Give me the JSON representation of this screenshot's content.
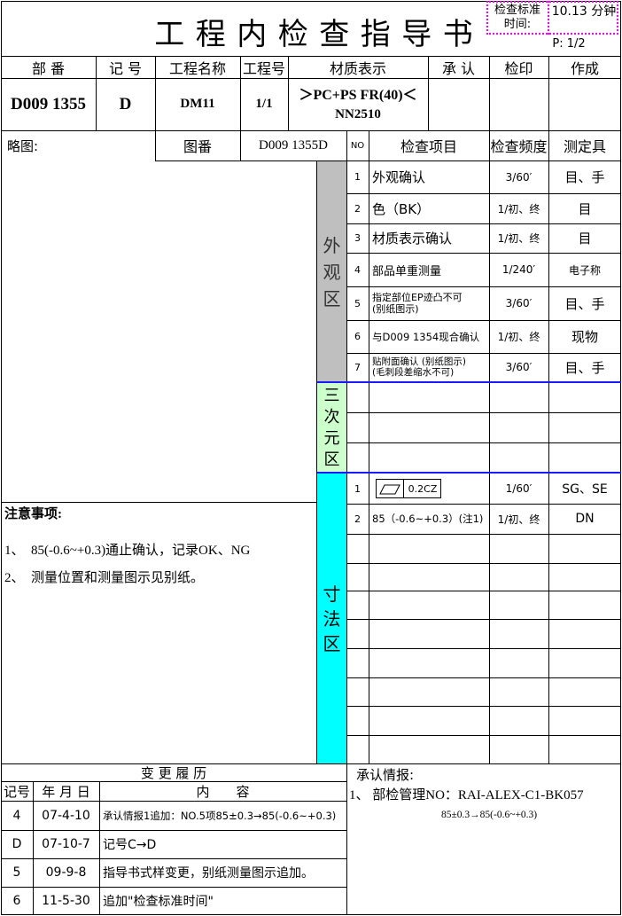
{
  "title": "工 程 内 检 查 指 导 书",
  "std_time": {
    "label": "检查标准\n时间:",
    "value": "10.13 分钟"
  },
  "page": "P: 1/2",
  "header": {
    "cols": [
      "部 番",
      "记 号",
      "工程名称",
      "工程号",
      "材质表示",
      "承 认",
      "检印",
      "作成"
    ],
    "values": {
      "part_no": "D009 1355",
      "mark": "D",
      "process_name": "DM11",
      "process_no": "1/1",
      "material_1": "＞PC+PS FR(40)＜",
      "material_2": "NN2510"
    }
  },
  "sketch": {
    "label": "略图:",
    "drawing_label": "图番",
    "drawing_no": "D009 1355D"
  },
  "check_header": {
    "no": "NO",
    "item": "检查项目",
    "freq": "检查频度",
    "tool": "测定具"
  },
  "zones": {
    "appearance": "外\n观\n区",
    "three_d": "三\n次\n元\n区",
    "dimension": "寸\n法\n区"
  },
  "appearance_rows": [
    {
      "no": "1",
      "item": "外观确认",
      "freq": "3/60′",
      "tool": "目、手"
    },
    {
      "no": "2",
      "item": "色（BK）",
      "freq": "1/初、终",
      "tool": "目"
    },
    {
      "no": "3",
      "item": "材质表示确认",
      "freq": "1/初、终",
      "tool": "目"
    },
    {
      "no": "4",
      "item": "部品单重测量",
      "freq": "1/240′",
      "tool": "电子称"
    },
    {
      "no": "5",
      "item": "指定部位EP迹凸不可\n(别纸图示)",
      "freq": "3/60′",
      "tool": "目、手"
    },
    {
      "no": "6",
      "item": "与D009 1354现合确认",
      "freq": "1/初、终",
      "tool": "现物"
    },
    {
      "no": "7",
      "item": "贴附面确认 (别纸图示)\n(毛刺段差缩水不可)",
      "freq": "3/60′",
      "tool": "目、手"
    }
  ],
  "dimension_rows": [
    {
      "no": "1",
      "item": "0.2CZ",
      "freq": "1/60′",
      "tool": "SG、SE"
    },
    {
      "no": "2",
      "item": "85（-0.6~+0.3）(注1)",
      "freq": "1/初、终",
      "tool": "DN"
    }
  ],
  "notes": {
    "title": "注意事项:",
    "items": [
      "1、　85(-0.6~+0.3)通止确认，记录OK、NG",
      "2、　测量位置和测量图示见别纸。"
    ]
  },
  "history": {
    "title": "变 更 履 历",
    "cols": [
      "记号",
      "年 月 日",
      "内　　容"
    ],
    "rows": [
      {
        "mark": "4",
        "date": "07-4-10",
        "content": "承认情报1追加：NO.5项85±0.3→85(-0.6~+0.3)"
      },
      {
        "mark": "D",
        "date": "07-10-7",
        "content": "记号C→D"
      },
      {
        "mark": "5",
        "date": "09-9-8",
        "content": "指导书式样变更，别纸测量图示追加。"
      },
      {
        "mark": "6",
        "date": "11-5-30",
        "content": "追加\"检查标准时间\""
      }
    ]
  },
  "approval": {
    "title": "承认情报:",
    "line1": "1、 部检管理NO：RAI-ALEX-C1-BK057",
    "line2": "85±0.3→85(-0.6~+0.3)"
  },
  "colors": {
    "appearance": "#bfbfbf",
    "three_d": "#ccffcc",
    "dimension": "#00ffff",
    "dotted": "#ff00ff",
    "divider": "#1a1aff"
  }
}
